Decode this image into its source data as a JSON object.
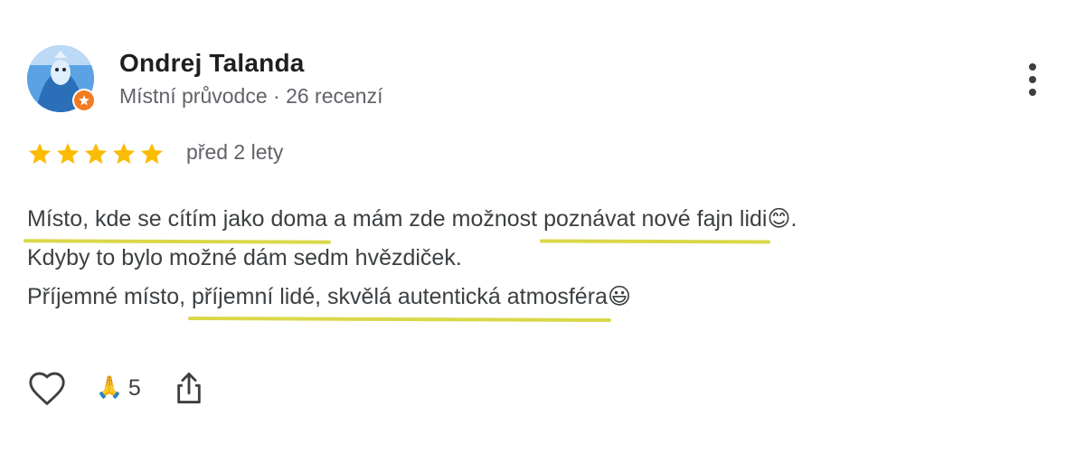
{
  "author": {
    "name": "Ondrej Talanda",
    "meta": "Místní průvodce · 26 recenzí",
    "avatar": "avatar-photo-dolphin",
    "badge": "local-guide-badge-icon"
  },
  "review": {
    "rating": 5,
    "max_rating": 5,
    "date": "před 2 lety",
    "lines": [
      [
        "Místo, kde se cítím jako doma",
        " a mám zde možnost ",
        "poznávat nové fajn lidi",
        "😊."
      ],
      [
        "Kdyby to bylo možné dám sedm hvězdiček."
      ],
      [
        "Příjemné místo, ",
        "příjemní lidé, skvělá autentická atmosféra",
        "😃"
      ]
    ],
    "highlight_color": "#d9d84a",
    "star_color": "#fbbc04"
  },
  "actions": {
    "like_icon": "heart-outline-icon",
    "reaction_emoji": "🙏",
    "reaction_count": "5",
    "share_icon": "share-icon",
    "more_icon": "more-vert-icon"
  }
}
